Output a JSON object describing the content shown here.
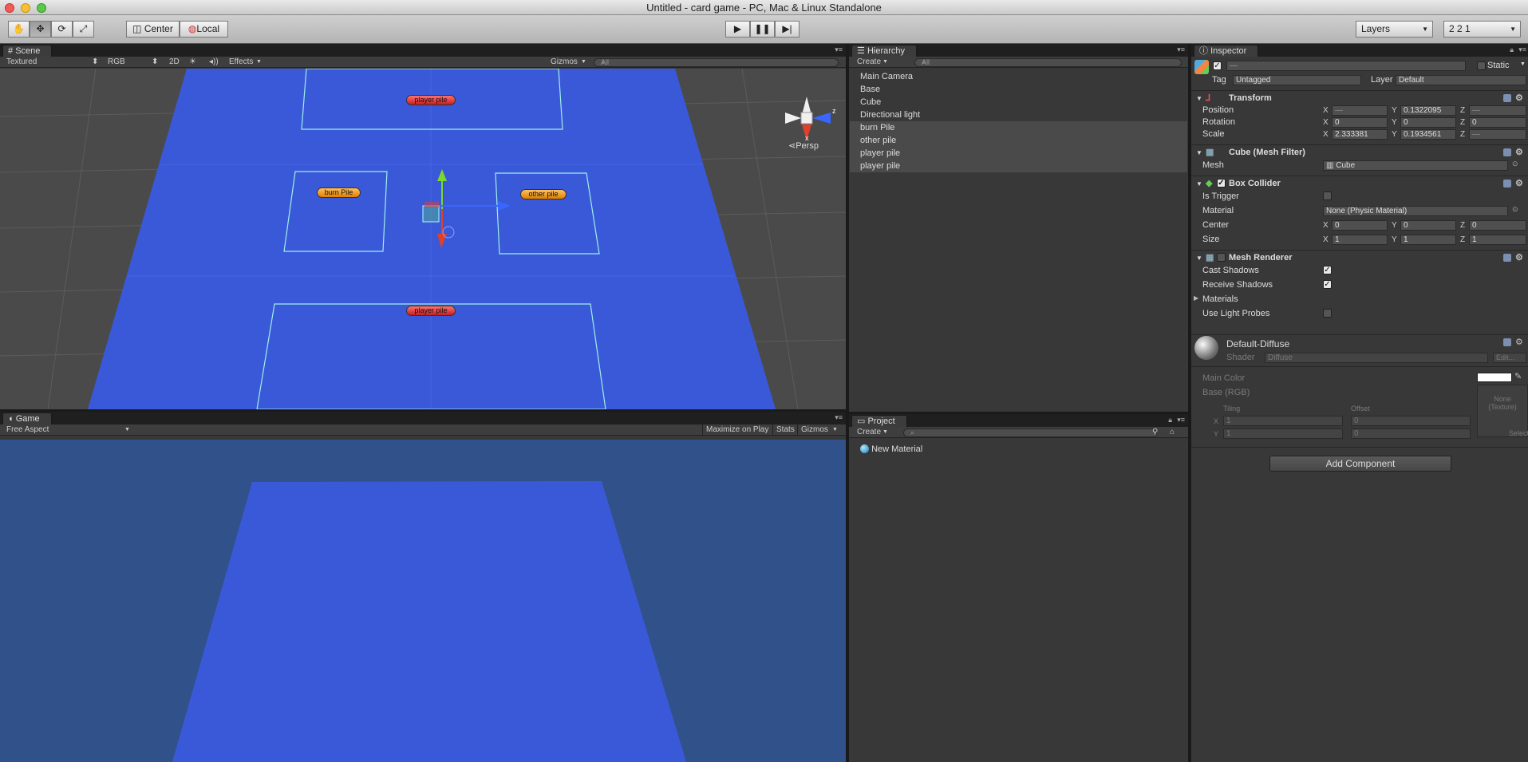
{
  "window": {
    "title": "Untitled - card game - PC, Mac & Linux Standalone"
  },
  "toolbar": {
    "pivot": "Center",
    "space": "Local",
    "layers": "Layers",
    "layout": "2 2 1"
  },
  "scene": {
    "tab": "Scene",
    "draw_mode": "Textured",
    "render_mode": "RGB",
    "two_d": "2D",
    "effects": "Effects",
    "gizmos": "Gizmos",
    "search_placeholder": "All",
    "labels": {
      "top": "player pile",
      "burn": "burn Pile",
      "other": "other pile",
      "bottom": "player pile"
    },
    "gizmo": {
      "z": "z",
      "x": "x",
      "persp": "Persp"
    }
  },
  "game": {
    "tab": "Game",
    "aspect": "Free Aspect",
    "maximize": "Maximize on Play",
    "stats": "Stats",
    "gizmos": "Gizmos"
  },
  "hierarchy": {
    "tab": "Hierarchy",
    "create": "Create",
    "search_placeholder": "All",
    "items": [
      {
        "label": "Main Camera"
      },
      {
        "label": "Base"
      },
      {
        "label": "Cube"
      },
      {
        "label": "Directional light"
      },
      {
        "label": "burn Pile"
      },
      {
        "label": "other pile"
      },
      {
        "label": "player pile"
      },
      {
        "label": "player pile"
      }
    ]
  },
  "project": {
    "tab": "Project",
    "create": "Create",
    "items": [
      {
        "label": "New Material"
      }
    ]
  },
  "inspector": {
    "tab": "Inspector",
    "name": "—",
    "static": "Static",
    "tag_label": "Tag",
    "tag": "Untagged",
    "layer_label": "Layer",
    "layer": "Default",
    "transform": {
      "title": "Transform",
      "position": "Position",
      "rotation": "Rotation",
      "scale": "Scale",
      "pos": {
        "x": "—",
        "y": "0.1322095",
        "z": "—"
      },
      "rot": {
        "x": "0",
        "y": "0",
        "z": "0"
      },
      "scl": {
        "x": "2.333381",
        "y": "0.1934561",
        "z": "—"
      }
    },
    "mesh_filter": {
      "title": "Cube (Mesh Filter)",
      "mesh_label": "Mesh",
      "mesh": "Cube"
    },
    "box_collider": {
      "title": "Box Collider",
      "is_trigger": "Is Trigger",
      "material_label": "Material",
      "material": "None (Physic Material)",
      "center": "Center",
      "size": "Size",
      "ctr": {
        "x": "0",
        "y": "0",
        "z": "0"
      },
      "sz": {
        "x": "1",
        "y": "1",
        "z": "1"
      }
    },
    "mesh_renderer": {
      "title": "Mesh Renderer",
      "cast": "Cast Shadows",
      "receive": "Receive Shadows",
      "materials": "Materials",
      "probes": "Use Light Probes"
    },
    "material": {
      "name": "Default-Diffuse",
      "shader_label": "Shader",
      "shader": "Diffuse",
      "edit": "Edit...",
      "main_color": "Main Color",
      "base": "Base (RGB)",
      "tiling": "Tiling",
      "offset": "Offset",
      "tx": "1",
      "ty": "1",
      "ox": "0",
      "oy": "0",
      "tex": "None\n(Texture)",
      "select": "Select"
    },
    "add_component": "Add Component",
    "axes": {
      "x": "X",
      "y": "Y",
      "z": "Z"
    }
  },
  "colors": {
    "plane": "#3a59d8",
    "game_bg": "#31518b",
    "panel": "#383838"
  }
}
